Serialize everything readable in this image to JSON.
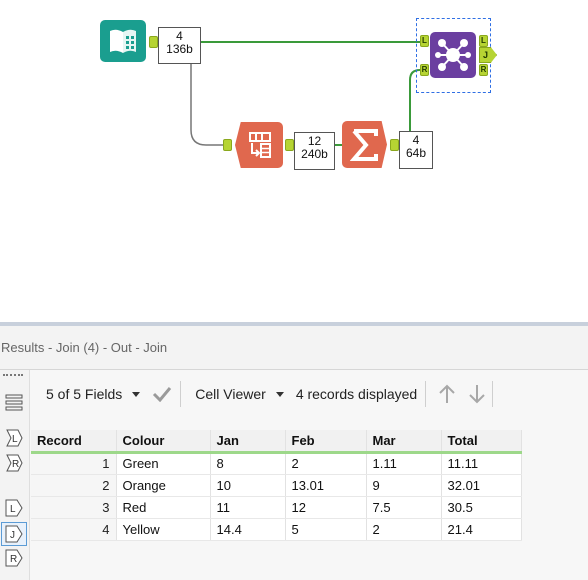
{
  "canvas": {
    "input_badge": {
      "records": "4",
      "size": "136b"
    },
    "transpose_badge": {
      "records": "12",
      "size": "240b"
    },
    "summarize_badge": {
      "records": "4",
      "size": "64b"
    },
    "join_ports": {
      "left": "L",
      "right": "R",
      "out_left": "L",
      "out_join": "J",
      "out_right": "R"
    },
    "colors": {
      "input": "#1a9e8f",
      "transpose": "#e0684e",
      "summarize": "#e0684e",
      "join": "#6b3fa0",
      "wire": "#3a9a3a",
      "wire_gray": "#777777"
    }
  },
  "results": {
    "title": "Results - Join (4) - Out - Join",
    "toolbar": {
      "fields_label": "5 of 5 Fields",
      "cell_viewer_label": "Cell Viewer",
      "records_displayed": "4 records displayed"
    },
    "sidebar_icons": [
      "list-icon",
      "left-input-icon",
      "right-input-icon",
      "left-output-icon",
      "join-output-icon",
      "right-output-icon"
    ],
    "table": {
      "columns": [
        "Record",
        "Colour",
        "Jan",
        "Feb",
        "Mar",
        "Total"
      ],
      "rows": [
        [
          "1",
          "Green",
          "8",
          "2",
          "1.11",
          "11.11"
        ],
        [
          "2",
          "Orange",
          "10",
          "13.01",
          "9",
          "32.01"
        ],
        [
          "3",
          "Red",
          "11",
          "12",
          "7.5",
          "30.5"
        ],
        [
          "4",
          "Yellow",
          "14.4",
          "5",
          "2",
          "21.4"
        ]
      ]
    }
  }
}
